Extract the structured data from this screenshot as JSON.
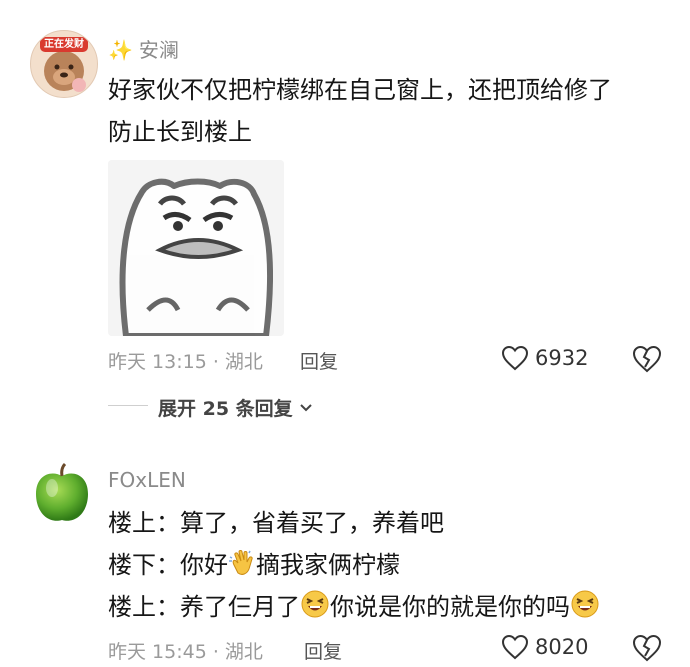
{
  "comment1": {
    "username_prefix": "✨",
    "username": "安澜",
    "avatar_text": "正在发财",
    "text_line1": "好家伙不仅把柠檬绑在自己窗上，还把顶给修了",
    "text_line2": "防止长到楼上",
    "meta": "昨天 13:15 · 湖北",
    "reply_label": "回复",
    "likes": "6932",
    "expand_label": "展开 25 条回复"
  },
  "comment2": {
    "username": "FOxLEN",
    "line1_label": "楼上：",
    "line1_text": "算了，省着买了，养着吧",
    "line2_label": "楼下：",
    "line2_text_a": "你好",
    "line2_text_b": "摘我家俩柠檬",
    "line3_label": "楼上：",
    "line3_text_a": "养了仨月了",
    "line3_text_b": "你说是你的就是你的吗",
    "meta": "昨天 15:45 · 湖北",
    "reply_label": "回复",
    "likes": "8020"
  },
  "icons": {
    "like": "heart-outline-icon",
    "dislike": "broken-heart-icon",
    "expand": "chevron-down-icon"
  },
  "colors": {
    "meta": "#9a9a9a",
    "text": "#161616",
    "apple": "#5fae2e",
    "avatar_bg": "#f3dfcc"
  }
}
